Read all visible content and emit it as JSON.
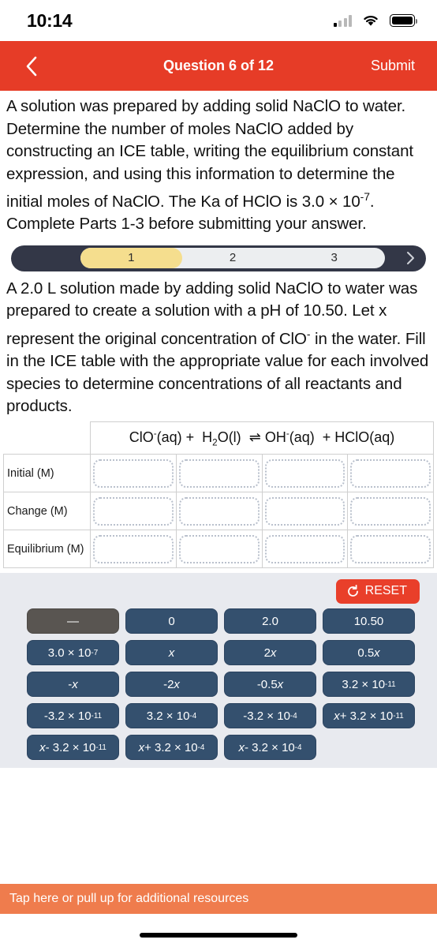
{
  "status_bar": {
    "time": "10:14",
    "signal_icon": "cellular-signal-icon",
    "wifi_icon": "wifi-icon",
    "battery_icon": "battery-icon"
  },
  "nav": {
    "back_icon": "chevron-left-icon",
    "title": "Question 6 of 12",
    "submit_label": "Submit"
  },
  "question": {
    "prompt_part1": "A solution was prepared by adding solid NaClO to water. Determine the number of moles NaClO added by constructing an ICE table, writing the equilibrium constant expression, and using this information to determine the initial moles of NaClO. The Ka of HClO is 3.0 × 10",
    "prompt_exp": "-7",
    "prompt_part2": ". Complete Parts 1-3 before submitting your answer.",
    "part_prompt_a": "A 2.0 L solution made by adding solid NaClO to water was prepared to create a solution with a pH of 10.50. Let x represent the original concentration of ClO",
    "part_prompt_sup": "-",
    "part_prompt_b": " in the water. Fill in the ICE table with the appropriate value for each involved species to determine concentrations of all reactants and products."
  },
  "steps": {
    "items": [
      "1",
      "2",
      "3"
    ],
    "active_index": 0,
    "next_icon": "chevron-right-icon",
    "active_color": "#f5de8e",
    "track_color": "#333747"
  },
  "ice_table": {
    "equation": {
      "reactant1": "ClO",
      "reactant1_sup": "-",
      "reactant1_state": "(aq)",
      "plus1": "+",
      "reactant2": "H",
      "reactant2_sub": "2",
      "reactant2_rest": "O(l)",
      "arrow": "⇌",
      "product1": "OH",
      "product1_sup": "-",
      "product1_state": "(aq)",
      "plus2": "+",
      "product2": "HClO(aq)"
    },
    "rows": [
      {
        "label": "Initial (M)",
        "cells": [
          "",
          "",
          "",
          ""
        ]
      },
      {
        "label": "Change (M)",
        "cells": [
          "",
          "",
          "",
          ""
        ]
      },
      {
        "label": "Equilibrium (M)",
        "cells": [
          "",
          "",
          "",
          ""
        ]
      }
    ]
  },
  "tray": {
    "reset_label": "RESET",
    "reset_icon": "refresh-icon",
    "reset_color": "#e93f2a",
    "tile_color": "#34506e",
    "tile_disabled_color": "#595551",
    "tile_rows": [
      [
        {
          "text": "—",
          "style": "gray"
        },
        {
          "text": "0",
          "style": "navy"
        },
        {
          "text": "2.0",
          "style": "navy"
        },
        {
          "text": "10.50",
          "style": "navy"
        }
      ],
      [
        {
          "text": "3.0 × 10",
          "sup": "-7",
          "style": "navy"
        },
        {
          "text": "x",
          "italic": true,
          "style": "navy"
        },
        {
          "text": "2x",
          "italic_tail": "x",
          "prefix": "2",
          "style": "navy"
        },
        {
          "text": "0.5x",
          "prefix": "0.5",
          "italic_tail": "x",
          "style": "navy"
        }
      ],
      [
        {
          "text": "-x",
          "prefix": "-",
          "italic_tail": "x",
          "style": "navy"
        },
        {
          "text": "-2x",
          "prefix": "-2",
          "italic_tail": "x",
          "style": "navy"
        },
        {
          "text": "-0.5x",
          "prefix": "-0.5",
          "italic_tail": "x",
          "style": "navy"
        },
        {
          "text": "3.2 × 10",
          "sup": "-11",
          "style": "navy"
        }
      ],
      [
        {
          "text": "-3.2 × 10",
          "sup": "-11",
          "style": "navy"
        },
        {
          "text": "3.2 × 10",
          "sup": "-4",
          "style": "navy"
        },
        {
          "text": "-3.2 × 10",
          "sup": "-4",
          "style": "navy"
        },
        {
          "text": "x + 3.2 × 10",
          "sup": "-11",
          "italic_lead": "x",
          "style": "navy"
        }
      ],
      [
        {
          "text": "x - 3.2 × 10",
          "sup": "-11",
          "italic_lead": "x",
          "style": "navy"
        },
        {
          "text": "x + 3.2 × 10",
          "sup": "-4",
          "italic_lead": "x",
          "style": "navy"
        },
        {
          "text": "x - 3.2 × 10",
          "sup": "-4",
          "italic_lead": "x",
          "style": "navy"
        }
      ]
    ]
  },
  "footer": {
    "resources_label": "Tap here or pull up for additional resources",
    "resources_color": "#ef7c4d"
  }
}
